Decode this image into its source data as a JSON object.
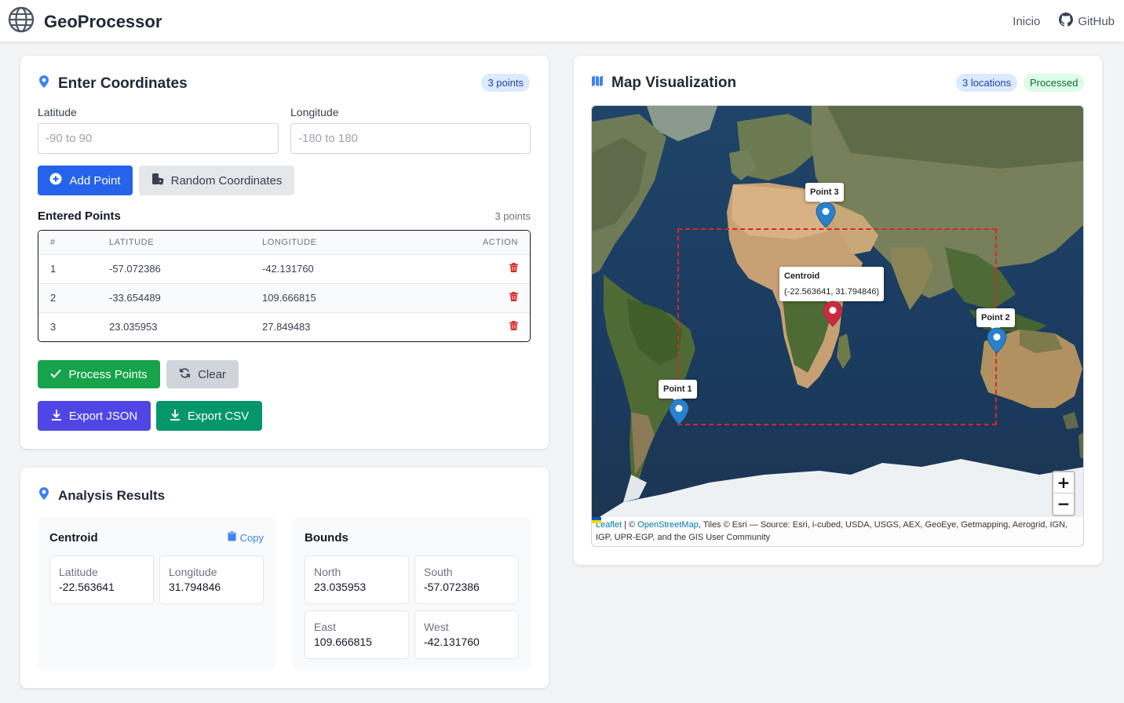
{
  "header": {
    "title": "GeoProcessor",
    "nav": {
      "home": "Inicio",
      "github": "GitHub"
    }
  },
  "entry": {
    "title": "Enter Coordinates",
    "badge": "3 points",
    "latitude": {
      "label": "Latitude",
      "placeholder": "-90 to 90",
      "value": ""
    },
    "longitude": {
      "label": "Longitude",
      "placeholder": "-180 to 180",
      "value": ""
    },
    "add_button": "Add Point",
    "random_button": "Random Coordinates",
    "list_label": "Entered Points",
    "list_count": "3 points",
    "table": {
      "headers": [
        "#",
        "LATITUDE",
        "LONGITUDE",
        "ACTION"
      ],
      "rows": [
        {
          "n": "1",
          "lat": "-57.072386",
          "lng": "-42.131760"
        },
        {
          "n": "2",
          "lat": "-33.654489",
          "lng": "109.666815"
        },
        {
          "n": "3",
          "lat": "23.035953",
          "lng": "27.849483"
        }
      ]
    },
    "process_button": "Process Points",
    "clear_button": "Clear",
    "export_json_button": "Export JSON",
    "export_csv_button": "Export CSV"
  },
  "analysis": {
    "title": "Analysis Results",
    "centroid": {
      "title": "Centroid",
      "copy": "Copy",
      "latitude_label": "Latitude",
      "latitude": "-22.563641",
      "longitude_label": "Longitude",
      "longitude": "31.794846"
    },
    "bounds": {
      "title": "Bounds",
      "north_label": "North",
      "north": "23.035953",
      "south_label": "South",
      "south": "-57.072386",
      "east_label": "East",
      "east": "109.666815",
      "west_label": "West",
      "west": "-42.131760"
    }
  },
  "map": {
    "title": "Map Visualization",
    "badge_locations": "3 locations",
    "badge_status": "Processed",
    "markers": {
      "p1": "Point 1",
      "p2": "Point 2",
      "p3": "Point 3",
      "centroid": "Centroid",
      "centroid_coords": "(-22.563641, 31.794846)"
    },
    "zoom_in": "+",
    "zoom_out": "−",
    "attribution": {
      "leaflet": "Leaflet",
      "sep": " | © ",
      "osm": "OpenStreetMap",
      "rest": ", Tiles © Esri — Source: Esri, i-cubed, USDA, USGS, AEX, GeoEye, Getmapping, Aerogrid, IGN, IGP, UPR-EGP, and the GIS User Community"
    }
  },
  "colors": {
    "primary": "#2563eb",
    "success": "#16a34a",
    "danger": "#dc2626",
    "indigo": "#4f46e5",
    "emerald": "#059669",
    "ocean": "#1d3a5c"
  }
}
